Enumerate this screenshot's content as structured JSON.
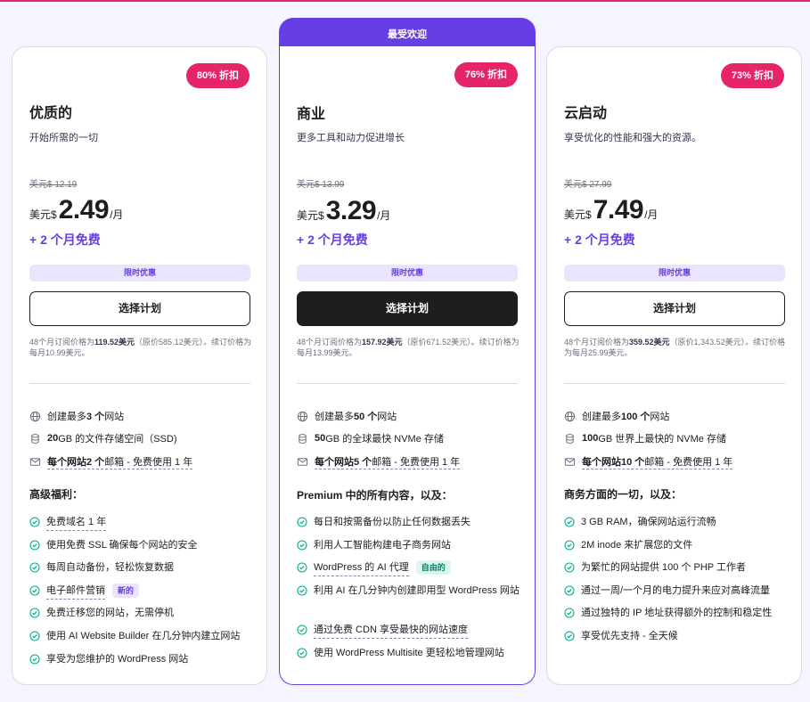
{
  "popular_label": "最受欢迎",
  "plans": [
    {
      "discount": "80% 折扣",
      "name": "优质的",
      "desc": "开始所需的一切",
      "old_price": "美元$ 12.19",
      "currency": "美元$",
      "price": "2.49",
      "per": "/月",
      "bonus": "+ 2 个月免费",
      "limited": "限时优惠",
      "button": "选择计划",
      "note_pre": "48个月订阅价格为",
      "note_bold": "119.52美元",
      "note_post": "（原价585.12美元）。续订价格为每月10.99美元。",
      "features": [
        {
          "pre": "创建最多",
          "bold": "3 个",
          "post": "网站"
        },
        {
          "pre": "",
          "bold": "20",
          "post": " GB 的文件存储空间（SSD)"
        },
        {
          "pre": "",
          "bold": "每个网站2 个",
          "post": "邮箱 - 免费使用 1 年"
        }
      ],
      "section_title": "高级福利：",
      "bullets": [
        {
          "text": "免费域名 1 年",
          "tag": ""
        },
        {
          "text": "使用免费 SSL 确保每个网站的安全",
          "tag": ""
        },
        {
          "text": "每周自动备份，轻松恢复数据",
          "tag": ""
        },
        {
          "text": "电子邮件营销",
          "tag": "新的"
        },
        {
          "text": "免费迁移您的网站，无需停机",
          "tag": ""
        },
        {
          "text": "使用 AI Website Builder 在几分钟内建立网站",
          "tag": ""
        },
        {
          "text": "享受为您维护的 WordPress 网站",
          "tag": ""
        }
      ]
    },
    {
      "discount": "76% 折扣",
      "name": "商业",
      "desc": "更多工具和动力促进增长",
      "old_price": "美元$ 13.99",
      "currency": "美元$",
      "price": "3.29",
      "per": "/月",
      "bonus": "+ 2 个月免费",
      "limited": "限时优惠",
      "button": "选择计划",
      "note_pre": "48个月订阅价格为",
      "note_bold": "157.92美元",
      "note_post": "（原价671.52美元）。续订价格为每月13.99美元。",
      "features": [
        {
          "pre": "创建最多",
          "bold": "50 个",
          "post": "网站"
        },
        {
          "pre": "",
          "bold": "50",
          "post": " GB 的全球最快 NVMe 存储"
        },
        {
          "pre": "",
          "bold": "每个网站5 个",
          "post": "邮箱 - 免费使用 1 年"
        }
      ],
      "section_title": "Premium 中的所有内容，以及：",
      "bullets": [
        {
          "text": "每日和按需备份以防止任何数据丢失",
          "tag": ""
        },
        {
          "text": "利用人工智能构建电子商务网站",
          "tag": ""
        },
        {
          "text": "WordPress 的 AI 代理",
          "tag": "自由的"
        },
        {
          "text": "利用 AI 在几分钟内创建即用型 WordPress 网站",
          "tag": ""
        },
        {
          "text": "通过免费 CDN 享受最快的网站速度",
          "tag": ""
        },
        {
          "text": "使用 WordPress Multisite 更轻松地管理网站",
          "tag": ""
        }
      ]
    },
    {
      "discount": "73% 折扣",
      "name": "云启动",
      "desc": "享受优化的性能和强大的资源。",
      "old_price": "美元$ 27.99",
      "currency": "美元$",
      "price": "7.49",
      "per": "/月",
      "bonus": "+ 2 个月免费",
      "limited": "限时优惠",
      "button": "选择计划",
      "note_pre": "48个月订阅价格为",
      "note_bold": "359.52美元",
      "note_post": "（原价1,343.52美元）。续订价格为每月25.99美元。",
      "features": [
        {
          "pre": "创建最多",
          "bold": "100 个",
          "post": "网站"
        },
        {
          "pre": "",
          "bold": "100",
          "post": " GB 世界上最快的 NVMe 存储"
        },
        {
          "pre": "",
          "bold": "每个网站10 个",
          "post": "邮箱 - 免费使用 1 年"
        }
      ],
      "section_title": "商务方面的一切，以及：",
      "bullets": [
        {
          "text": "3 GB RAM，确保网站运行流畅",
          "tag": ""
        },
        {
          "text": "2M inode 来扩展您的文件",
          "tag": ""
        },
        {
          "text": "为繁忙的网站提供 100 个 PHP 工作者",
          "tag": ""
        },
        {
          "text": "通过一周/一个月的电力提升来应对高峰流量",
          "tag": ""
        },
        {
          "text": "通过独特的 IP 地址获得额外的控制和稳定性",
          "tag": ""
        },
        {
          "text": "享受优先支持 - 全天候",
          "tag": ""
        }
      ]
    }
  ],
  "colors": {
    "accent": "#673de6",
    "badge": "#e5246a"
  },
  "icons": [
    "globe-icon",
    "database-icon",
    "mail-icon",
    "check-circle-icon"
  ]
}
